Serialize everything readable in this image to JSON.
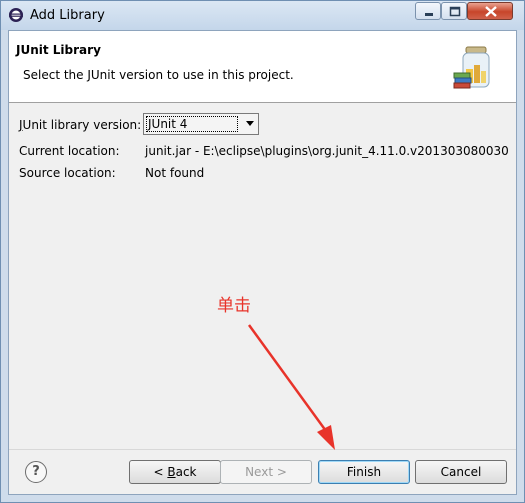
{
  "window": {
    "title": "Add Library"
  },
  "header": {
    "title": "JUnit Library",
    "description": "Select the JUnit version to use in this project."
  },
  "form": {
    "version_label": "JUnit library version:",
    "version_label_mnemonic": "J",
    "version_label_rest": "Unit library version:",
    "version_value": "JUnit 4",
    "current_location_label": "Current location:",
    "current_location_value": "junit.jar - E:\\eclipse\\plugins\\org.junit_4.11.0.v201303080030",
    "source_location_label": "Source location:",
    "source_location_value": "Not found"
  },
  "annotation": {
    "text": "单击",
    "color": "#e8332a"
  },
  "buttons": {
    "help": "?",
    "back_pre": "< ",
    "back_mnemonic": "B",
    "back_post": "ack",
    "next": "Next >",
    "finish": "Finish",
    "cancel": "Cancel"
  },
  "icons": [
    "eclipse-app-icon",
    "minimize-icon",
    "maximize-icon",
    "close-icon",
    "library-jar-icon",
    "help-icon",
    "red-arrow-annotation"
  ]
}
